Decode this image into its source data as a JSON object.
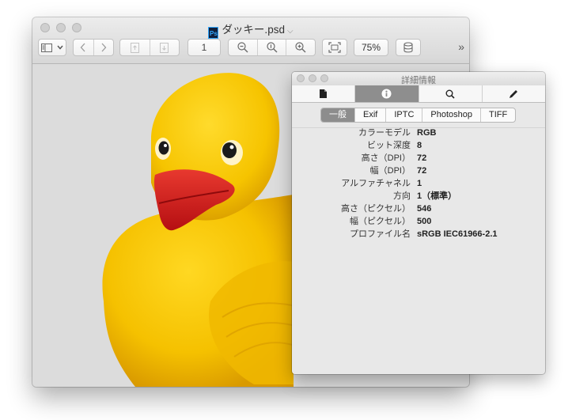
{
  "window": {
    "title": "ダッキー.psd",
    "file_icon": "photoshop-file-icon",
    "toolbar": {
      "page_number": "1",
      "zoom": "75%"
    }
  },
  "inspector": {
    "title": "詳細情報",
    "tabs": [
      {
        "icon": "document-icon"
      },
      {
        "icon": "info-icon",
        "active": true
      },
      {
        "icon": "search-icon"
      },
      {
        "icon": "pencil-icon"
      }
    ],
    "subtabs": [
      "一般",
      "Exif",
      "IPTC",
      "Photoshop",
      "TIFF"
    ],
    "active_subtab": "一般",
    "properties": [
      {
        "key": "カラーモデル",
        "value": "RGB"
      },
      {
        "key": "ビット深度",
        "value": "8"
      },
      {
        "key": "高さ（DPI）",
        "value": "72"
      },
      {
        "key": "幅（DPI）",
        "value": "72"
      },
      {
        "key": "アルファチャネル",
        "value": "1"
      },
      {
        "key": "方向",
        "value": "1（標準）"
      },
      {
        "key": "高さ（ピクセル）",
        "value": "546"
      },
      {
        "key": "幅（ピクセル）",
        "value": "500"
      },
      {
        "key": "プロファイル名",
        "value": "sRGB IEC61966-2.1"
      }
    ]
  },
  "colors": {
    "duck_body": "#f6c700",
    "duck_beak": "#d21d1d",
    "canvas_bg": "#dcdcdc"
  }
}
